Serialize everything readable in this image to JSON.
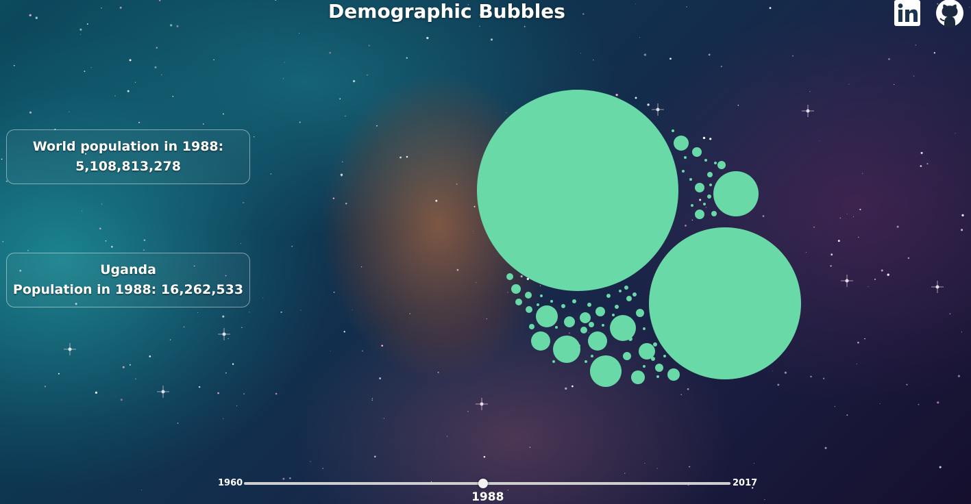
{
  "header": {
    "title": "Demographic Bubbles",
    "links": [
      {
        "name": "linkedin",
        "icon": "linkedin-icon"
      },
      {
        "name": "github",
        "icon": "github-icon"
      }
    ]
  },
  "world_box": {
    "line1": "World population in 1988:",
    "line2": "5,108,813,278"
  },
  "country_box": {
    "country": "Uganda",
    "population_line": "Population in 1988: 16,262,533"
  },
  "year_slider": {
    "min_label": "1960",
    "max_label": "2017",
    "min": 1960,
    "max": 2017,
    "value": 1988,
    "value_label": "1988"
  },
  "colors": {
    "bubble": "#6ad9a8",
    "text": "#ffffff"
  }
}
